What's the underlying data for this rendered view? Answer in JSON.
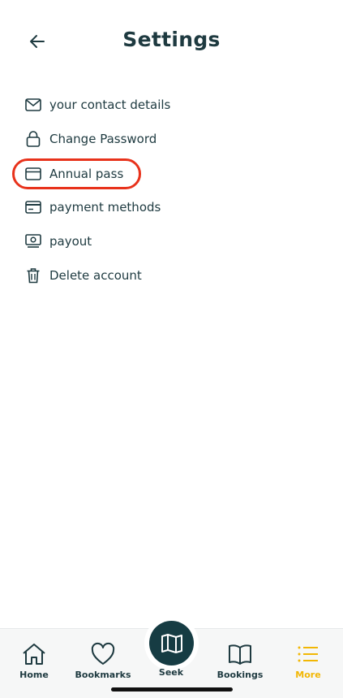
{
  "header": {
    "title": "Settings",
    "back_icon": "arrow-left-icon"
  },
  "menu": {
    "items": [
      {
        "label": "your contact details",
        "icon": "envelope-icon"
      },
      {
        "label": "Change Password",
        "icon": "lock-icon"
      },
      {
        "label": "Annual pass",
        "icon": "card-icon",
        "highlighted": true
      },
      {
        "label": "payment methods",
        "icon": "credit-card-icon"
      },
      {
        "label": "payout",
        "icon": "cash-icon"
      },
      {
        "label": "Delete account",
        "icon": "trash-icon"
      }
    ]
  },
  "tabbar": {
    "home": "Home",
    "bookmarks": "Bookmarks",
    "seek": "Seek",
    "bookings": "Bookings",
    "more": "More",
    "active": "More"
  },
  "colors": {
    "text": "#1e3a40",
    "accent": "#f2b705",
    "highlight": "#e8321b",
    "seek_bg": "#163c43"
  }
}
